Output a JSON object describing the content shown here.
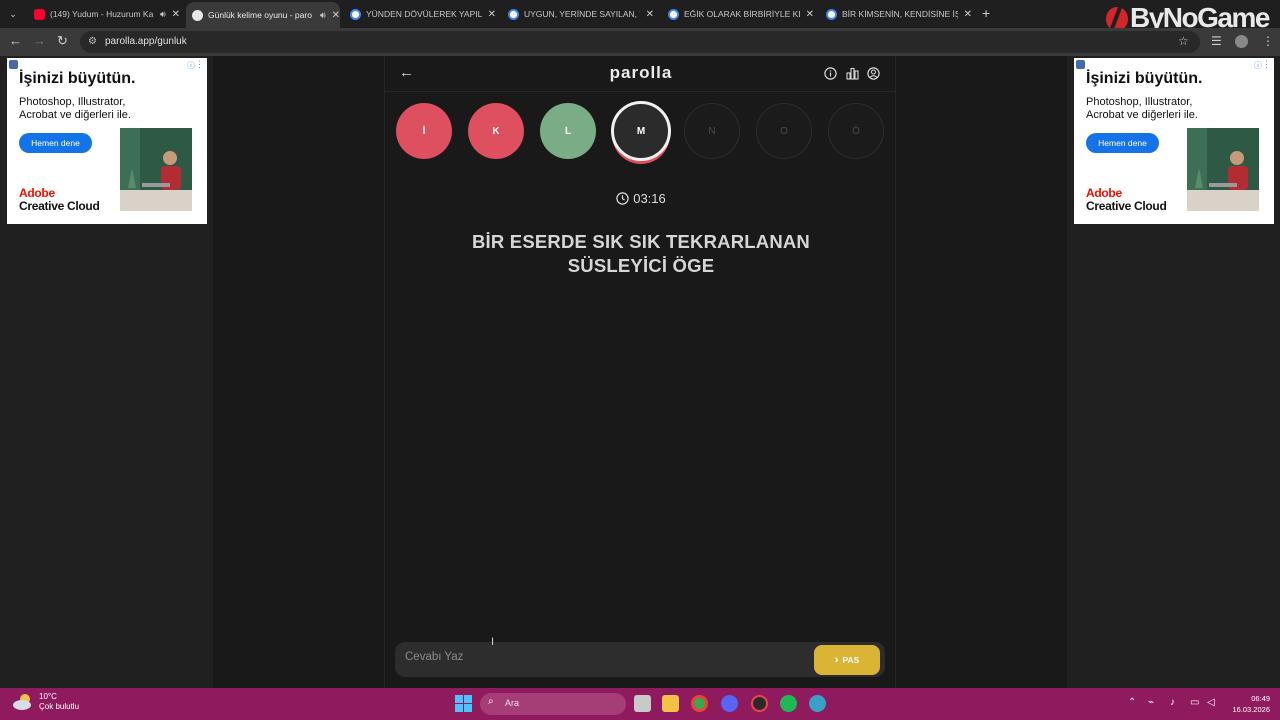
{
  "browser": {
    "tabs": [
      {
        "title": "(149) Yudum - Huzurum Ka",
        "favicon": "youtube-icon",
        "audio": true,
        "active": false,
        "color": "#ff0033"
      },
      {
        "title": "Günlük kelime oyunu - paro",
        "favicon": "parolla-icon",
        "audio": true,
        "active": true,
        "color": "#e7e7e7"
      },
      {
        "title": "YÜNDEN DÖVÜLEREK YAPILAN",
        "favicon": "google-icon",
        "audio": false,
        "active": false,
        "color": "#4285f4"
      },
      {
        "title": "UYGUN, YERİNDE SAYILAN, YA",
        "favicon": "google-icon",
        "audio": false,
        "active": false,
        "color": "#4285f4"
      },
      {
        "title": "EĞİK OLARAK BİRBİRİYLE KESİŞ",
        "favicon": "google-icon",
        "audio": false,
        "active": false,
        "color": "#4285f4"
      },
      {
        "title": "BİR KİMSENİN, KENDİSİNE İŞ V",
        "favicon": "google-icon",
        "audio": false,
        "active": false,
        "color": "#4285f4"
      }
    ],
    "new_tab": "+",
    "url": "parolla.app/gunluk",
    "watermark": "ByNoGame"
  },
  "ads": {
    "headline": "İşinizi büyütün.",
    "body": "Photoshop, Illustrator, Acrobat ve diğerleri ile.",
    "cta": "Hemen dene",
    "brand_line1": "Adobe",
    "brand_line2": "Creative Cloud",
    "brand_color": "#eb1000",
    "cta_color": "#1473e6"
  },
  "game": {
    "logo": "parolla",
    "letters": [
      {
        "char": "İ",
        "state": "wrong"
      },
      {
        "char": "K",
        "state": "wrong"
      },
      {
        "char": "L",
        "state": "correct"
      },
      {
        "char": "M",
        "state": "current"
      },
      {
        "char": "N",
        "state": "pending"
      },
      {
        "char": "O",
        "state": "pending"
      },
      {
        "char": "Ö",
        "state": "pending"
      }
    ],
    "colors": {
      "wrong": "#de4f60",
      "correct": "#7aad85",
      "pass_button": "#d9b435"
    },
    "timer": "03:16",
    "clue": "BİR ESERDE SIK SIK TEKRARLANAN SÜSLEYİCİ ÖGE",
    "answer_placeholder": "Cevabı Yaz",
    "pass_label": "PAS"
  },
  "taskbar": {
    "temperature": "10°C",
    "weather": "Çok bulutlu",
    "search_label": "Ara",
    "time": "06:49",
    "date": "16.03.2026"
  }
}
